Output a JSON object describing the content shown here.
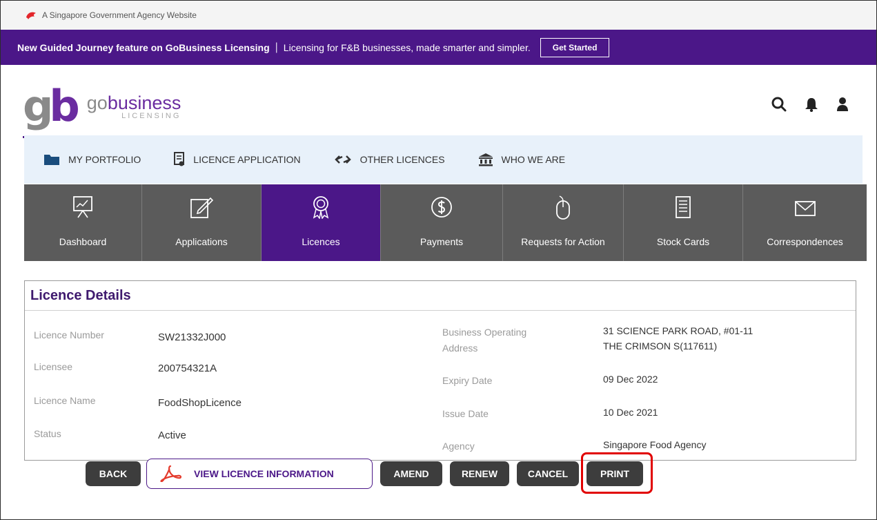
{
  "gov_banner": {
    "text": "A Singapore Government Agency Website"
  },
  "promo": {
    "title": "New Guided Journey feature on GoBusiness Licensing",
    "separator": "|",
    "subtitle": "Licensing for F&B businesses, made smarter and simpler.",
    "cta": "Get Started"
  },
  "logo": {
    "mark_g": "g",
    "mark_b": "b",
    "word_go": "go",
    "word_business": "business",
    "word_sub": "LICENSING"
  },
  "header_icons": [
    "search-icon",
    "bell-icon",
    "user-icon"
  ],
  "top_nav": [
    {
      "label": "MY PORTFOLIO",
      "icon": "folder-icon"
    },
    {
      "label": "LICENCE APPLICATION",
      "icon": "document-icon"
    },
    {
      "label": "OTHER LICENCES",
      "icon": "exchange-icon"
    },
    {
      "label": "WHO WE ARE",
      "icon": "building-icon"
    }
  ],
  "tiles": [
    {
      "label": "Dashboard",
      "icon": "presentation-icon",
      "active": false
    },
    {
      "label": "Applications",
      "icon": "edit-icon",
      "active": false
    },
    {
      "label": "Licences",
      "icon": "award-icon",
      "active": true
    },
    {
      "label": "Payments",
      "icon": "dollar-icon",
      "active": false
    },
    {
      "label": "Requests for Action",
      "icon": "mouse-icon",
      "active": false
    },
    {
      "label": "Stock Cards",
      "icon": "list-document-icon",
      "active": false
    },
    {
      "label": "Correspondences",
      "icon": "envelope-icon",
      "active": false
    }
  ],
  "details": {
    "title": "Licence Details",
    "left": [
      {
        "label": "Licence Number",
        "value": "SW21332J000"
      },
      {
        "label": "Licensee",
        "value": "200754321A"
      },
      {
        "label": "Licence Name",
        "value": "FoodShopLicence"
      },
      {
        "label": "Status",
        "value": "Active"
      }
    ],
    "right": [
      {
        "label_line1": "Business Operating",
        "label_line2": "Address",
        "value_line1": "31 SCIENCE PARK ROAD, #01-11",
        "value_line2": "THE CRIMSON S(117611)"
      },
      {
        "label": "Expiry Date",
        "value": "09 Dec 2022"
      },
      {
        "label": "Issue Date",
        "value": "10 Dec 2021"
      },
      {
        "label": "Agency",
        "value": "Singapore Food Agency"
      }
    ]
  },
  "actions": {
    "back": "BACK",
    "view": "VIEW LICENCE INFORMATION",
    "amend": "AMEND",
    "renew": "RENEW",
    "cancel": "CANCEL",
    "print": "PRINT"
  },
  "colors": {
    "brand_purple": "#4b1788",
    "tile_gray": "#5b5b5b",
    "highlight_red": "#e10000"
  }
}
